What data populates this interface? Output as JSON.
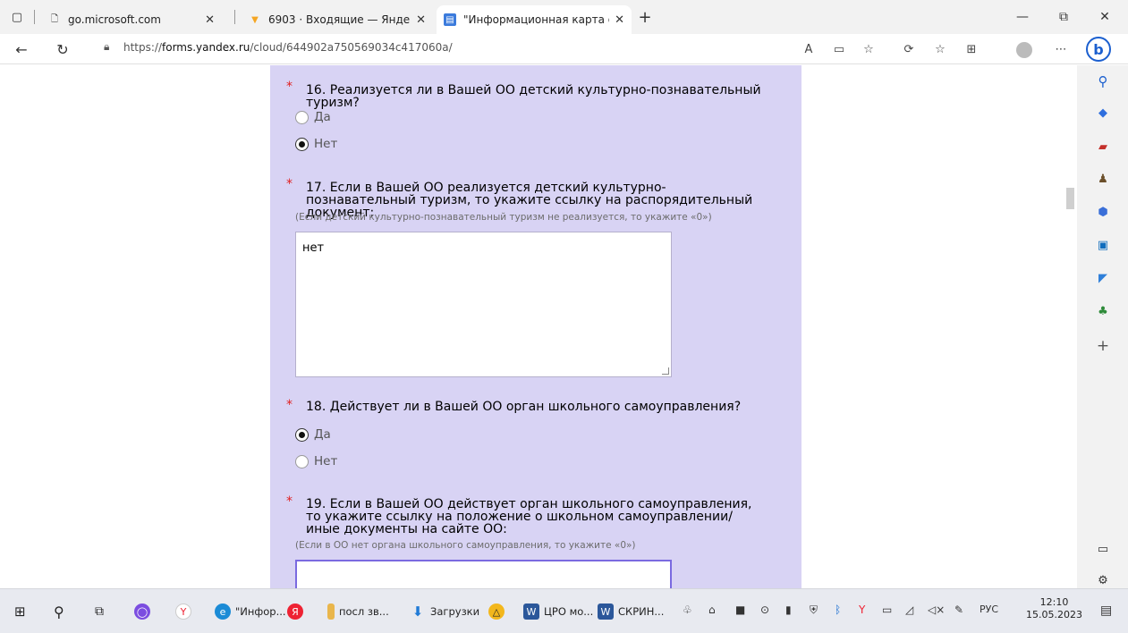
{
  "tabs": [
    {
      "label": "go.microsoft.com"
    },
    {
      "label": "6903 · Входящие — Яндекс Почт"
    },
    {
      "label": "\"Информационная карта общео"
    }
  ],
  "address": {
    "prefix": "https://",
    "domain": "forms.yandex.ru",
    "path": "/cloud/644902a750569034c417060a/"
  },
  "questions": {
    "q16": {
      "title": "16. Реализуется ли в Вашей ОО детский культурно-познавательный туризм?",
      "opt1": "Да",
      "opt2": "Нет",
      "selected": "Нет"
    },
    "q17": {
      "title": "17. Если в Вашей ОО реализуется детский культурно-познавательный туризм, то укажите ссылку на распорядительный документ:",
      "hint": "(Если детский культурно-познавательный туризм не реализуется, то укажите «0»)",
      "value": "нет"
    },
    "q18": {
      "title": "18. Действует ли в Вашей ОО орган школьного самоуправления?",
      "opt1": "Да",
      "opt2": "Нет",
      "selected": "Да"
    },
    "q19": {
      "title": "19. Если в Вашей ОО действует орган школьного самоуправления, то укажите ссылку на положение о школьном самоуправлении/иные документы на сайте ОО:",
      "hint": "(Если в ОО нет органа школьного самоуправления, то укажите «0»)",
      "value": ""
    }
  },
  "required_mark": "*",
  "taskbar": {
    "items": [
      {
        "label": "\"Инфор..."
      },
      {
        "label": "посл зв..."
      },
      {
        "label": "Загрузки"
      },
      {
        "label": "ЦРО мо..."
      },
      {
        "label": "СКРИН..."
      }
    ],
    "lang": "РУС",
    "time": "12:10",
    "date": "15.05.2023"
  },
  "colors": {
    "form_bg": "#d8d3f4",
    "required": "#e02020",
    "focus_border": "#7a6ae0",
    "bing": "#1b5fcf"
  }
}
